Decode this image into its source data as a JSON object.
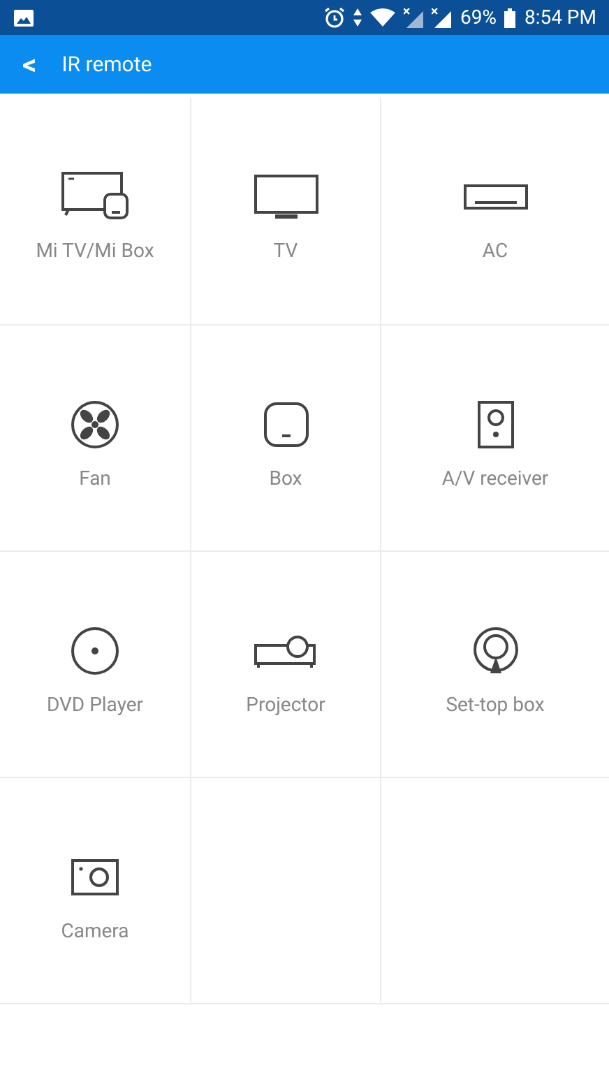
{
  "status_bar": {
    "battery_text": "69%",
    "time": "8:54 PM"
  },
  "app_bar": {
    "back": "<",
    "title": "IR remote"
  },
  "devices": [
    {
      "kind": "mitv",
      "label": "Mi TV/Mi Box"
    },
    {
      "kind": "tv",
      "label": "TV"
    },
    {
      "kind": "ac",
      "label": "AC"
    },
    {
      "kind": "fan",
      "label": "Fan"
    },
    {
      "kind": "box",
      "label": "Box"
    },
    {
      "kind": "receiver",
      "label": "A/V receiver"
    },
    {
      "kind": "dvd",
      "label": "DVD Player"
    },
    {
      "kind": "projector",
      "label": "Projector"
    },
    {
      "kind": "settop",
      "label": "Set-top box"
    },
    {
      "kind": "camera",
      "label": "Camera"
    }
  ]
}
